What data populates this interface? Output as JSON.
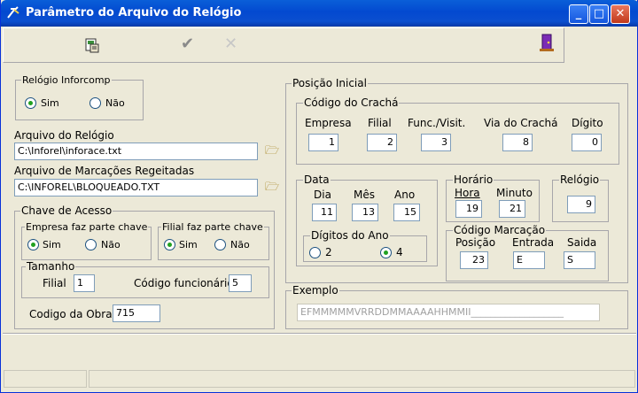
{
  "window": {
    "title": "Parâmetro do Arquivo do Relógio"
  },
  "toolbar": {
    "save_icon": "save-icon",
    "confirm_icon": "check-icon",
    "cancel_icon": "cancel-icon",
    "exit_icon": "exit-door-icon"
  },
  "relogio_inforcomp": {
    "label": "Relógio Inforcomp",
    "sim": "Sim",
    "nao": "Não",
    "selected": "Sim"
  },
  "arquivo_relogio": {
    "label": "Arquivo do Relógio",
    "value": "C:\\Inforel\\inforace.txt"
  },
  "arquivo_rejeitadas": {
    "label": "Arquivo de Marcações Regeitadas",
    "value": "C:\\INFOREL\\BLOQUEADO.TXT"
  },
  "chave_acesso": {
    "label": "Chave de Acesso",
    "empresa": {
      "label": "Empresa faz parte chave",
      "sim": "Sim",
      "nao": "Não",
      "selected": "Sim"
    },
    "filial": {
      "label": "Filial faz parte chave",
      "sim": "Sim",
      "nao": "Não",
      "selected": "Sim"
    },
    "tamanho": {
      "label": "Tamanho",
      "filial_label": "Filial",
      "filial_value": "1",
      "func_label": "Código funcionário",
      "func_value": "5"
    },
    "obra": {
      "label": "Codigo da Obra:",
      "value": "715"
    }
  },
  "posicao_inicial": {
    "label": "Posição Inicial",
    "cracha": {
      "label": "Código do Crachá",
      "empresa": "Empresa",
      "empresa_v": "1",
      "filial": "Filial",
      "filial_v": "2",
      "func": "Func./Visit.",
      "func_v": "3",
      "via": "Via do Crachá",
      "via_v": "8",
      "digito": "Dígito",
      "digito_v": "0"
    },
    "data": {
      "label": "Data",
      "dia": "Dia",
      "dia_v": "11",
      "mes": "Mês",
      "mes_v": "13",
      "ano": "Ano",
      "ano_v": "15",
      "digitos": {
        "label": "Dígitos do Ano",
        "o2": "2",
        "o4": "4",
        "selected": "4"
      }
    },
    "horario": {
      "label": "Horário",
      "hora": "Hora",
      "hora_v": "19",
      "minuto": "Minuto",
      "minuto_v": "21"
    },
    "relogio": {
      "label": "Relógio",
      "value": "9"
    },
    "marcacao": {
      "label": "Código Marcação",
      "posicao": "Posição",
      "posicao_v": "23",
      "entrada": "Entrada",
      "entrada_v": "E",
      "saida": "Saida",
      "saida_v": "S"
    }
  },
  "exemplo": {
    "label": "Exemplo",
    "value": "EFMMMMMVRRDDMMAAAAHHMMII___________________"
  }
}
